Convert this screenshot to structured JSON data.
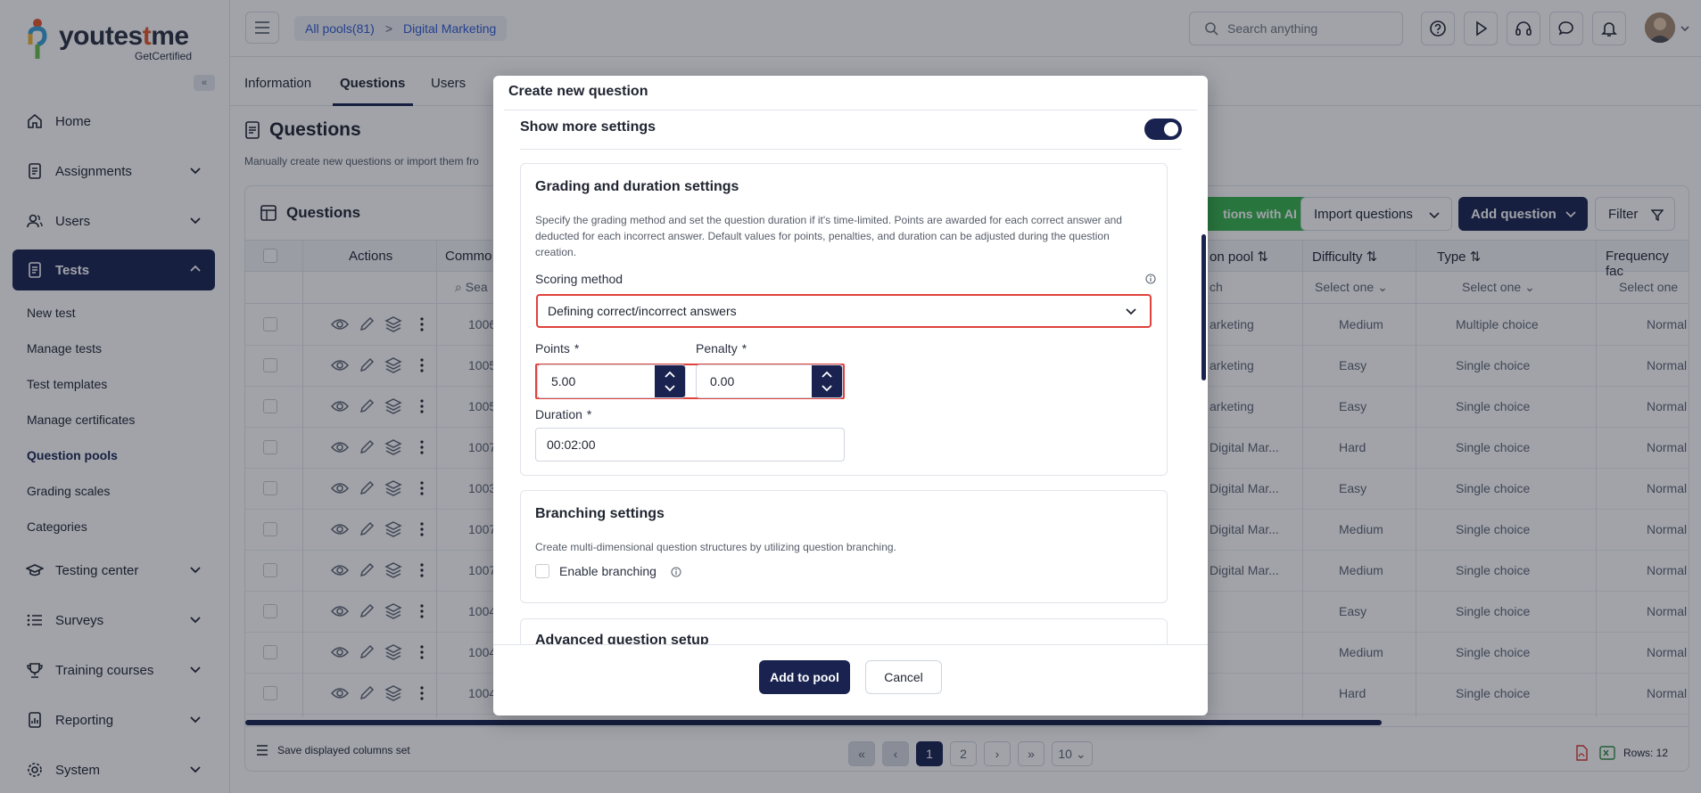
{
  "logo": {
    "brand_prefix": "youtes",
    "brand_accent": "t",
    "brand_suffix": "me",
    "tagline": "GetCertified"
  },
  "sidebar": {
    "collapse_icon": "«",
    "items": [
      {
        "label": "Home",
        "icon": "home-icon"
      },
      {
        "label": "Assignments",
        "icon": "document-icon"
      },
      {
        "label": "Users",
        "icon": "users-icon"
      },
      {
        "label": "Tests",
        "icon": "tests-icon"
      },
      {
        "label": "Testing center",
        "icon": "graduation-icon"
      },
      {
        "label": "Surveys",
        "icon": "list-icon"
      },
      {
        "label": "Training courses",
        "icon": "trophy-icon"
      },
      {
        "label": "Reporting",
        "icon": "report-icon"
      },
      {
        "label": "System",
        "icon": "gear-icon"
      }
    ],
    "sub_items": [
      "New test",
      "Manage tests",
      "Test templates",
      "Manage certificates",
      "Question pools",
      "Grading scales",
      "Categories"
    ]
  },
  "topbar": {
    "breadcrumb": {
      "root": "All pools(81)",
      "sep": ">",
      "current": "Digital Marketing"
    },
    "search_placeholder": "Search anything"
  },
  "tabs": [
    "Information",
    "Questions",
    "Users"
  ],
  "page": {
    "title": "Questions",
    "description": "Manually create new questions or import them fro"
  },
  "card": {
    "title": "Questions",
    "ai_button": "tions with AI",
    "import_button": "Import questions",
    "add_button": "Add question",
    "filter_button": "Filter",
    "columns": {
      "actions": "Actions",
      "common": "Commo",
      "pool": "on pool",
      "difficulty": "Difficulty",
      "type": "Type",
      "frequency": "Frequency fac"
    },
    "filters": {
      "search": "Sea",
      "pool_search": "ch",
      "difficulty": "Select one",
      "type": "Select one",
      "frequency": "Select one"
    },
    "rows": [
      {
        "id": "1006",
        "pool": "arketing",
        "difficulty": "Medium",
        "type": "Multiple choice",
        "freq": "Normal"
      },
      {
        "id": "1005",
        "pool": "arketing",
        "difficulty": "Easy",
        "type": "Single choice",
        "freq": "Normal"
      },
      {
        "id": "1005",
        "pool": "arketing",
        "difficulty": "Easy",
        "type": "Single choice",
        "freq": "Normal"
      },
      {
        "id": "1007",
        "pool": "Digital Mar...",
        "difficulty": "Hard",
        "type": "Single choice",
        "freq": "Normal"
      },
      {
        "id": "1003",
        "pool": "Digital Mar...",
        "difficulty": "Easy",
        "type": "Single choice",
        "freq": "Normal"
      },
      {
        "id": "1007",
        "pool": "Digital Mar...",
        "difficulty": "Medium",
        "type": "Single choice",
        "freq": "Normal"
      },
      {
        "id": "1007",
        "pool": "Digital Mar...",
        "difficulty": "Medium",
        "type": "Single choice",
        "freq": "Normal"
      },
      {
        "id": "1004",
        "pool": "",
        "difficulty": "Easy",
        "type": "Single choice",
        "freq": "Normal"
      },
      {
        "id": "1004",
        "pool": "",
        "difficulty": "Medium",
        "type": "Single choice",
        "freq": "Normal"
      },
      {
        "id": "1004",
        "pool": "",
        "difficulty": "Hard",
        "type": "Single choice",
        "freq": "Normal"
      }
    ],
    "footer": {
      "save_columns": "Save displayed columns set",
      "pages": [
        "1",
        "2"
      ],
      "rows_per_page": "10",
      "rows_count": "Rows: 12"
    }
  },
  "modal": {
    "title": "Create new question",
    "show_more_settings": "Show more settings",
    "grading": {
      "title": "Grading and duration settings",
      "description": "Specify the grading method and set the question duration if it's time-limited. Points are awarded for each correct answer and deducted for each incorrect answer. Default values for points, penalties, and duration can be adjusted during the question creation.",
      "scoring_label": "Scoring method",
      "scoring_value": "Defining correct/incorrect answers",
      "points_label": "Points",
      "points_value": "5.00",
      "penalty_label": "Penalty",
      "penalty_value": "0.00",
      "duration_label": "Duration",
      "duration_value": "00:02:00",
      "required_mark": "*"
    },
    "branching": {
      "title": "Branching settings",
      "description": "Create multi-dimensional question structures by utilizing question branching.",
      "enable_label": "Enable branching"
    },
    "advanced": {
      "title": "Advanced question setup"
    },
    "add_button": "Add to pool",
    "cancel_button": "Cancel"
  },
  "colors": {
    "primary": "#1a2350",
    "accent_green": "#37b24d",
    "highlight_red": "#e0413b",
    "link_blue": "#2f5bd3"
  }
}
